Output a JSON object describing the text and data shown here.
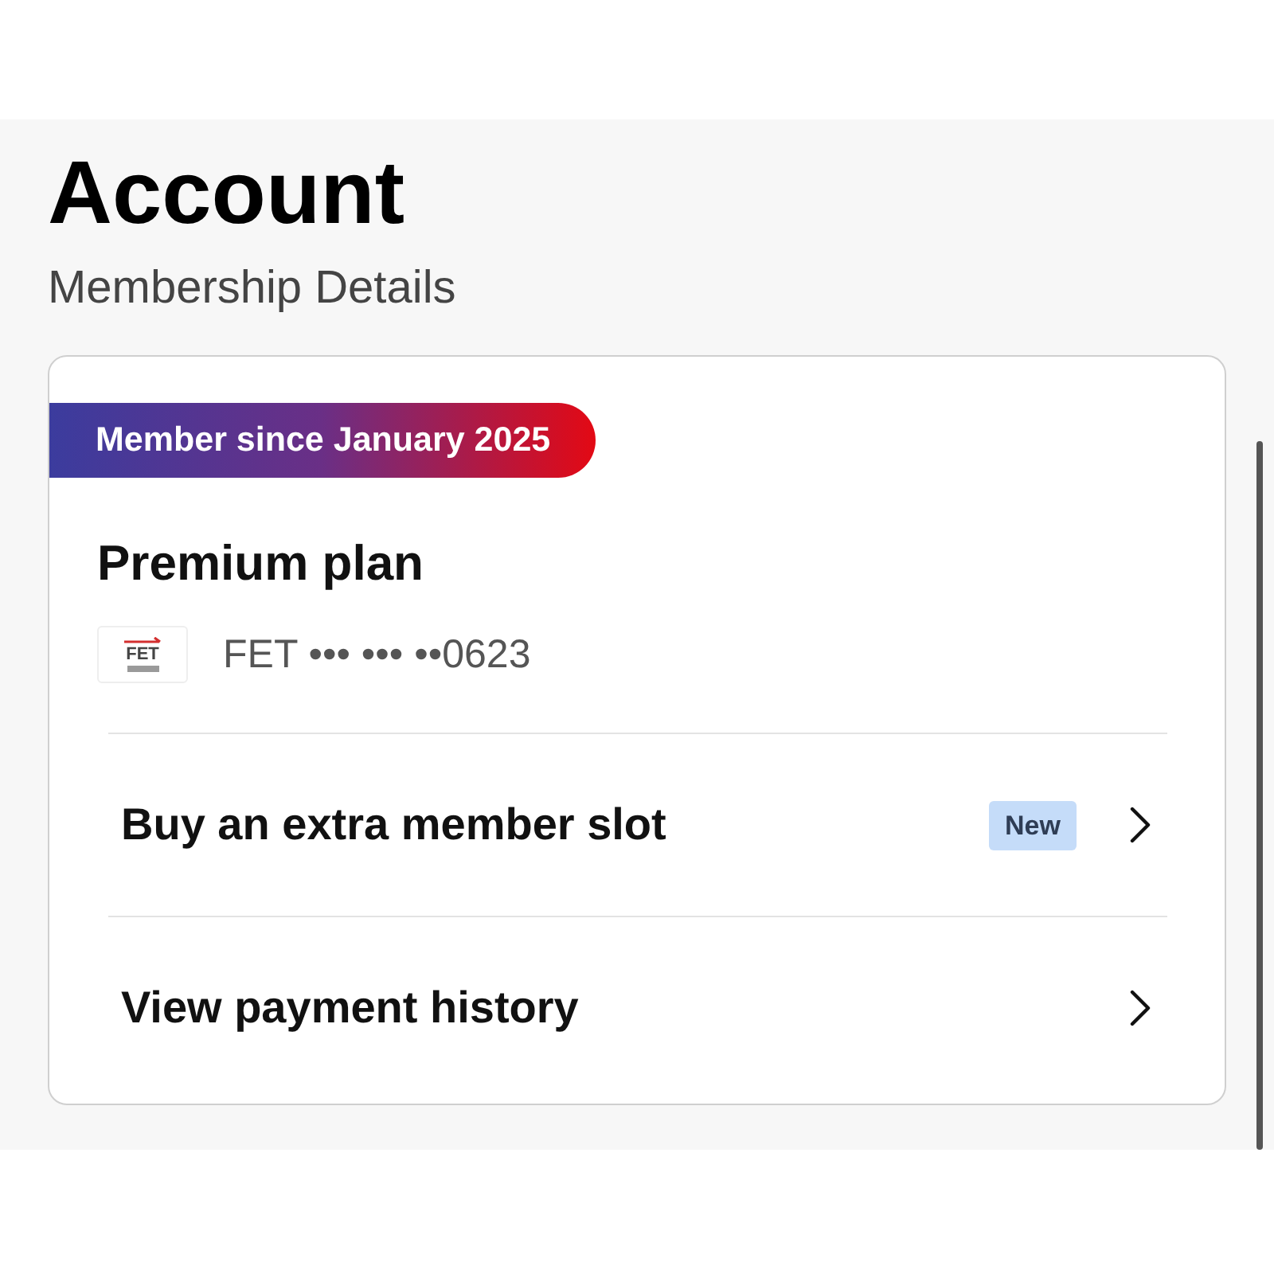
{
  "page": {
    "title": "Account",
    "subtitle": "Membership Details"
  },
  "membership": {
    "badge": "Member since January 2025",
    "plan": "Premium plan",
    "payment": {
      "logo_text": "FET",
      "masked_number": "FET ••• ••• ••0623"
    },
    "actions": [
      {
        "label": "Buy an extra member slot",
        "tag": "New"
      },
      {
        "label": "View payment history"
      }
    ]
  }
}
